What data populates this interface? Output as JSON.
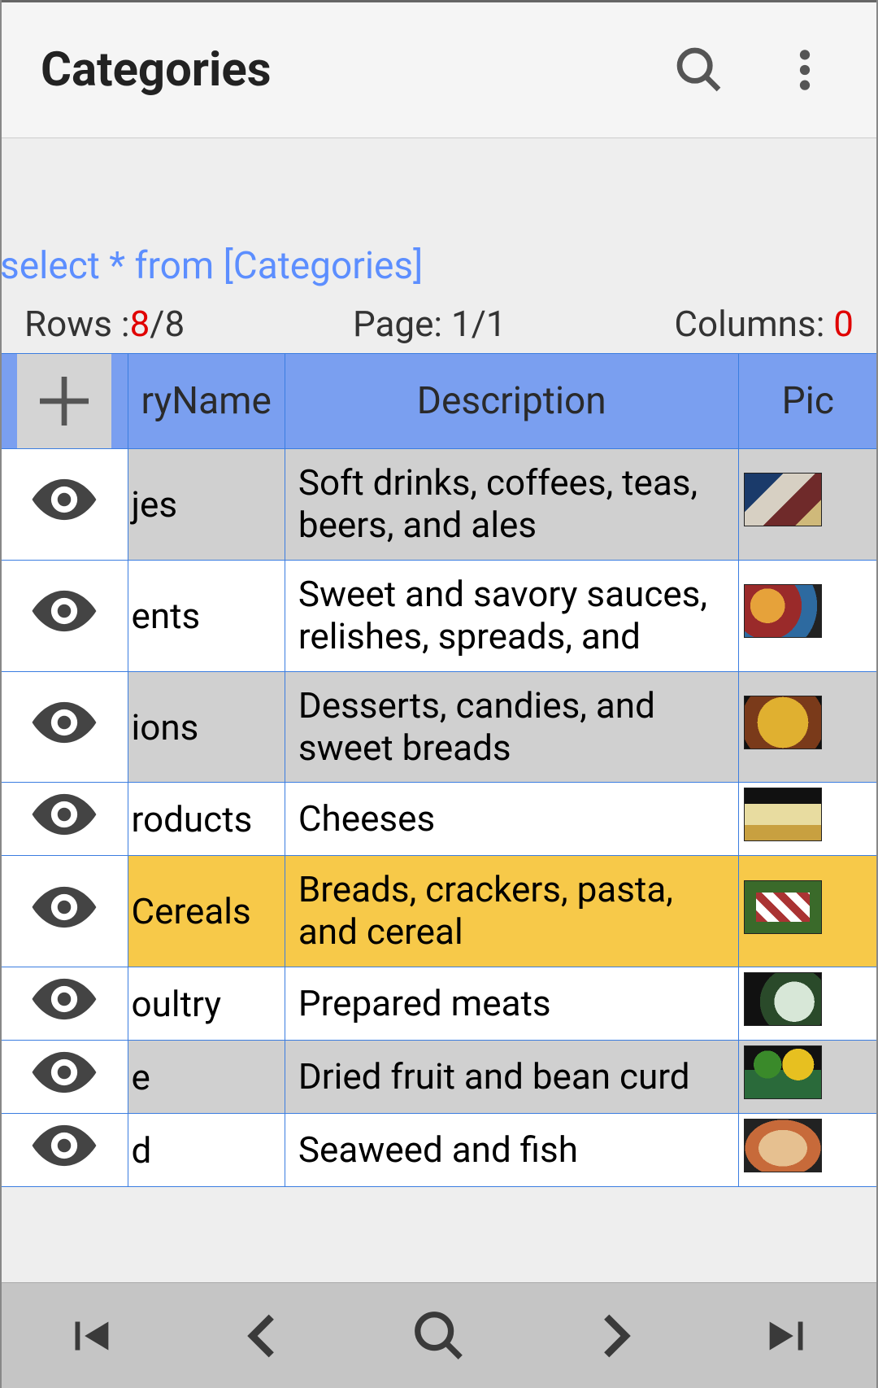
{
  "header": {
    "title": "Categories"
  },
  "query": "select * from [Categories]",
  "stats": {
    "rows_label": "Rows :",
    "rows_current": "8",
    "rows_total": "/8",
    "page_label": "Page: ",
    "page_value": "1/1",
    "cols_label": "Columns: ",
    "cols_value": "0"
  },
  "columns": {
    "name": "ryName",
    "desc": "Description",
    "pic": "Pic"
  },
  "rows": [
    {
      "name": "jes",
      "desc": "Soft drinks, coffees, teas, beers, and ales",
      "alt": true,
      "sel": false
    },
    {
      "name": "ents",
      "desc": "Sweet and savory sauces, relishes, spreads, and",
      "alt": false,
      "sel": false
    },
    {
      "name": "ions",
      "desc": "Desserts, candies, and sweet breads",
      "alt": true,
      "sel": false
    },
    {
      "name": "roducts",
      "desc": "Cheeses",
      "alt": false,
      "sel": false
    },
    {
      "name": "Cereals",
      "desc": "Breads, crackers, pasta, and cereal",
      "alt": false,
      "sel": true
    },
    {
      "name": "oultry",
      "desc": "Prepared meats",
      "alt": false,
      "sel": false
    },
    {
      "name": "e",
      "desc": "Dried fruit and bean curd",
      "alt": true,
      "sel": false
    },
    {
      "name": "d",
      "desc": "Seaweed and fish",
      "alt": false,
      "sel": false
    }
  ]
}
